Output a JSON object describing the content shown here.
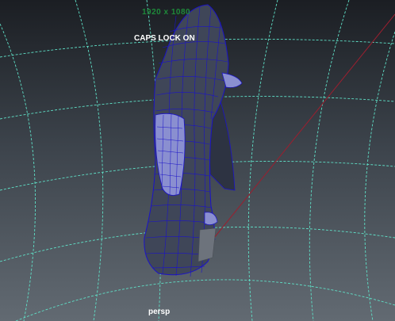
{
  "viewport": {
    "resolution_label": "1920 x 1080",
    "caps_lock_label": "CAPS LOCK ON",
    "camera_label": "persp"
  },
  "colors": {
    "grid": "#5fe0c7",
    "axis": "#9b1f2f",
    "mesh_fill": "#3f4658",
    "wireframe": "#1b13c8",
    "hud_green": "#1e8a3a",
    "hud_white": "#ffffff"
  }
}
